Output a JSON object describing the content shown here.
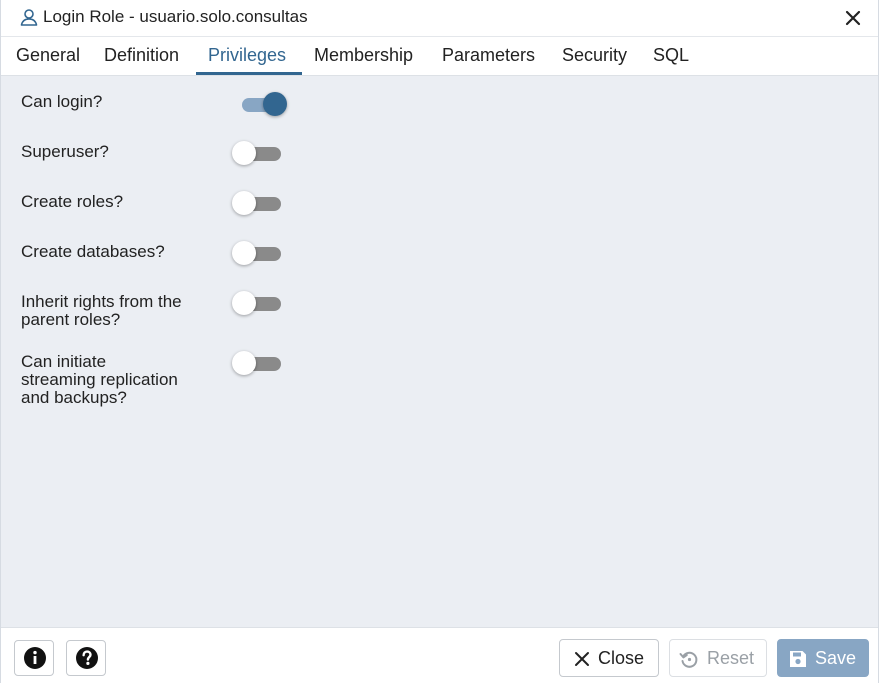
{
  "window": {
    "title": "Login Role - usuario.solo.consultas",
    "title_icon": "user-icon",
    "close_icon": "close-icon"
  },
  "tabs": [
    {
      "label": "General",
      "active": false
    },
    {
      "label": "Definition",
      "active": false
    },
    {
      "label": "Privileges",
      "active": true
    },
    {
      "label": "Membership",
      "active": false
    },
    {
      "label": "Parameters",
      "active": false
    },
    {
      "label": "Security",
      "active": false
    },
    {
      "label": "SQL",
      "active": false
    }
  ],
  "privileges": {
    "can_login": {
      "label": "Can login?",
      "value": true
    },
    "superuser": {
      "label": "Superuser?",
      "value": false
    },
    "create_roles": {
      "label": "Create roles?",
      "value": false
    },
    "create_databases": {
      "label": "Create databases?",
      "value": false
    },
    "inherit": {
      "label_line1": "Inherit rights from the",
      "label_line2": "parent roles?",
      "value": false
    },
    "replication": {
      "label_line1": "Can initiate",
      "label_line2": "streaming replication",
      "label_line3": "and backups?",
      "value": false
    }
  },
  "footer": {
    "info_icon": "info-icon",
    "help_icon": "help-icon",
    "close_label": "Close",
    "reset_label": "Reset",
    "save_label": "Save"
  },
  "colors": {
    "accent": "#326690",
    "switch_on_track": "#88a6c4",
    "switch_off_track": "#8a8a8a",
    "content_bg": "#ebeef3",
    "save_bg": "#88a6c4"
  }
}
